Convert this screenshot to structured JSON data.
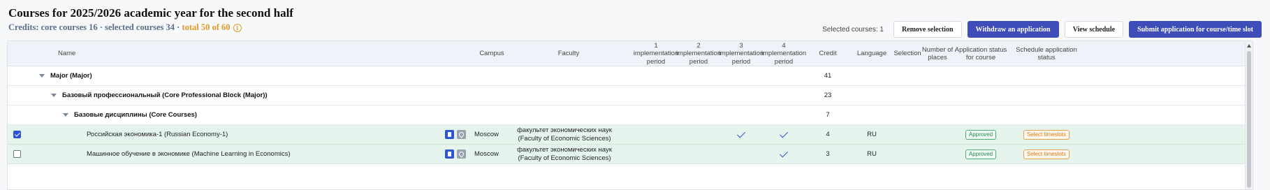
{
  "page": {
    "title": "Courses for 2025/2026 academic year for the second half",
    "credits_prefix": "Credits: core courses 16 · selected courses 34 · ",
    "credits_total": "total 50 of 60",
    "info_glyph": "i",
    "info_icon": "info-icon"
  },
  "toolbar": {
    "selected_count": "Selected courses: 1",
    "remove_selection": "Remove selection",
    "withdraw": "Withdraw an application",
    "view_schedule": "View schedule",
    "submit": "Submit application for course/time slot"
  },
  "columns": {
    "name": "Name",
    "campus": "Campus",
    "faculty": "Faculty",
    "p1": "1 implementation period",
    "p2": "2 implementation period",
    "p3": "3 implementation period",
    "p4": "4 implementation period",
    "credit": "Credit",
    "language": "Language",
    "selection": "Selection",
    "places": "Number of places",
    "app_status": "Application status for course",
    "sched_status": "Schedule application status"
  },
  "groups": [
    {
      "name": "Major (Major)",
      "credit": "41"
    },
    {
      "name": "Базовый профессиональный (Core Professional Block (Major))",
      "credit": "23"
    },
    {
      "name": "Базовые дисциплины (Core Courses)",
      "credit": "7"
    }
  ],
  "courses": [
    {
      "checked": true,
      "name": "Российская экономика-1 (Russian Economy-1)",
      "campus": "Moscow",
      "faculty": "факультет экономических наук (Faculty of Economic Sciences)",
      "periods": [
        false,
        false,
        true,
        true
      ],
      "credit": "4",
      "language": "RU",
      "app_status": "Approved",
      "sched_status": "Select timeslots"
    },
    {
      "checked": false,
      "name": "Машинное обучение в экономике (Machine Learning in Economics)",
      "campus": "Moscow",
      "faculty": "факультет экономических наук (Faculty of Economic Sciences)",
      "periods": [
        false,
        false,
        false,
        true
      ],
      "credit": "3",
      "language": "RU",
      "app_status": "Approved",
      "sched_status": "Select timeslots"
    }
  ],
  "colors": {
    "primary": "#3f4db8",
    "accent_orange": "#e39a25",
    "approved_green": "#1f8a4c",
    "course_row_bg": "#e5f4ec"
  }
}
